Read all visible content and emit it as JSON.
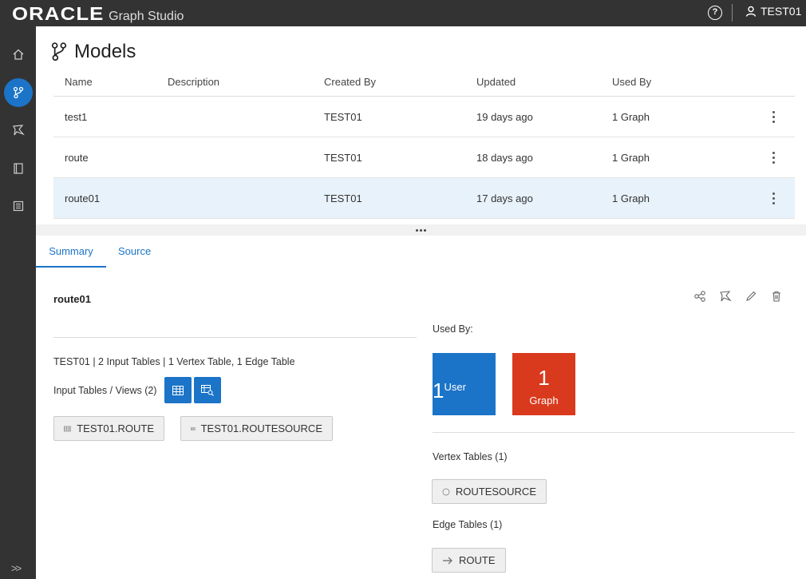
{
  "app": {
    "brand": "ORACLE",
    "product": "Graph Studio",
    "help_icon": "help-circle-icon",
    "user_name": "TEST01"
  },
  "sidebar": {
    "items": [
      {
        "name": "home",
        "icon": "home-icon",
        "active": false
      },
      {
        "name": "models",
        "icon": "model-icon",
        "active": true
      },
      {
        "name": "graphs",
        "icon": "graph-icon",
        "active": false
      },
      {
        "name": "notebooks",
        "icon": "notebook-icon",
        "active": false
      },
      {
        "name": "jobs",
        "icon": "jobs-icon",
        "active": false
      }
    ],
    "collapse_label": ">>"
  },
  "page": {
    "title": "Models"
  },
  "table": {
    "columns": [
      "Name",
      "Description",
      "Created By",
      "Updated",
      "Used By"
    ],
    "rows": [
      {
        "name": "test1",
        "description": "",
        "created_by": "TEST01",
        "updated": "19 days ago",
        "used_by": "1 Graph",
        "selected": false
      },
      {
        "name": "route",
        "description": "",
        "created_by": "TEST01",
        "updated": "18 days ago",
        "used_by": "1 Graph",
        "selected": false
      },
      {
        "name": "route01",
        "description": "",
        "created_by": "TEST01",
        "updated": "17 days ago",
        "used_by": "1 Graph",
        "selected": true
      }
    ]
  },
  "tabs": {
    "summary": "Summary",
    "source": "Source",
    "active": "Summary"
  },
  "detail": {
    "name": "route01",
    "summary_line": "TEST01 | 2 Input Tables | 1 Vertex Table, 1 Edge Table",
    "input_tables_label": "Input Tables / Views (2)",
    "input_tables": [
      "TEST01.ROUTE",
      "TEST01.ROUTESOURCE"
    ],
    "used_by_label": "Used By:",
    "used_by": [
      {
        "count": "1",
        "label": "User",
        "color": "#1b74c7"
      },
      {
        "count": "1",
        "label": "Graph",
        "color": "#d93a1e"
      }
    ],
    "vertex_tables_label": "Vertex Tables (1)",
    "vertex_tables": [
      "ROUTESOURCE"
    ],
    "edge_tables_label": "Edge Tables (1)",
    "edge_tables": [
      "ROUTE"
    ]
  },
  "colors": {
    "accent": "#1b74c7",
    "graph_tile": "#d93a1e",
    "chrome": "#333333",
    "selected_row": "#e8f2fa"
  }
}
